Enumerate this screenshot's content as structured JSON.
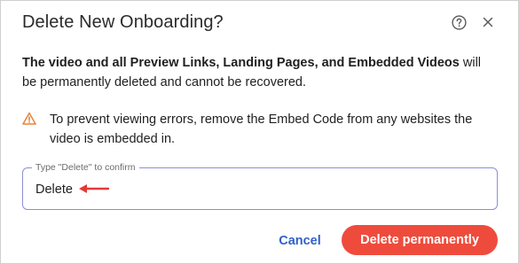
{
  "dialog": {
    "title": "Delete New Onboarding?",
    "help_icon": "question-circle-icon",
    "close_icon": "close-icon"
  },
  "message": {
    "bold": "The video and all Preview Links, Landing Pages, and Embedded Videos",
    "rest": " will be permanently deleted and cannot be recovered."
  },
  "warning": {
    "icon": "warning-triangle-icon",
    "text": "To prevent viewing errors, remove the Embed Code from any websites the video is embedded in."
  },
  "confirm_field": {
    "label": "Type \"Delete\" to confirm",
    "value": "Delete"
  },
  "actions": {
    "cancel_label": "Cancel",
    "delete_label": "Delete permanently"
  },
  "colors": {
    "accent_blue": "#3060c8",
    "danger": "#ef4b3c",
    "warning": "#e8833a",
    "field_border": "#8a8fd6"
  }
}
